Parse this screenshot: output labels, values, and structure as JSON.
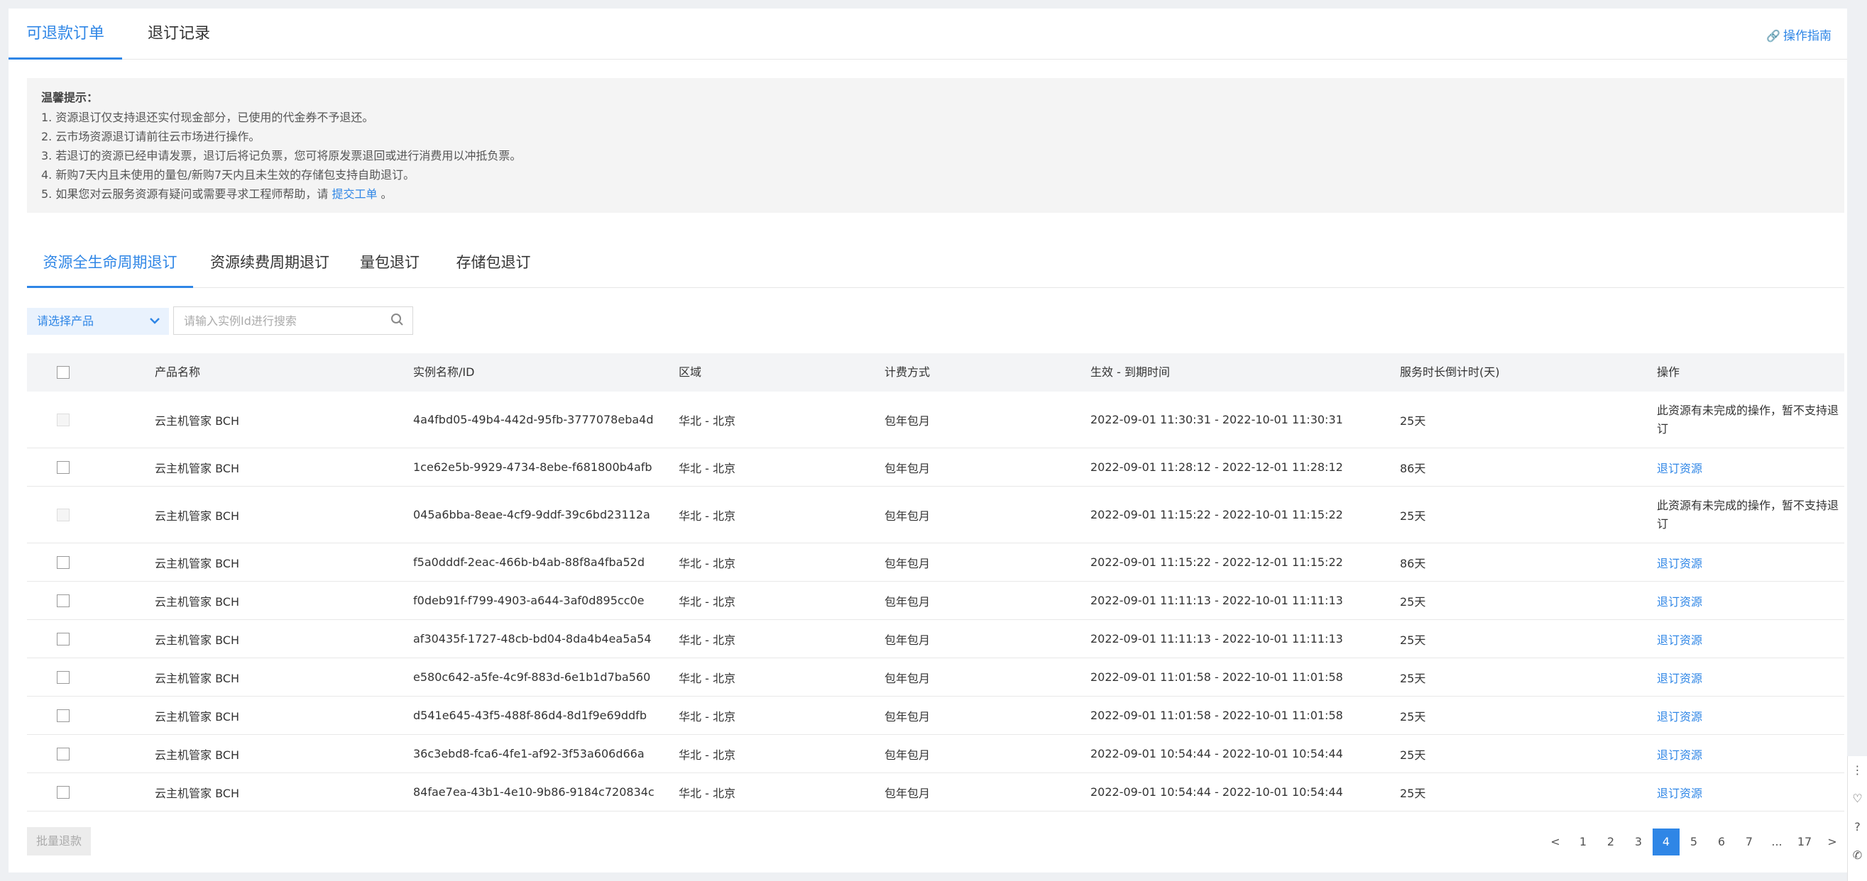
{
  "top_tabs": [
    {
      "label": "可退款订单",
      "active": true
    },
    {
      "label": "退订记录",
      "active": false
    }
  ],
  "guide_link": "操作指南",
  "notice": {
    "title": "温馨提示：",
    "lines": [
      "1. 资源退订仅支持退还实付现金部分，已使用的代金券不予退还。",
      "2. 云市场资源退订请前往云市场进行操作。",
      "3. 若退订的资源已经申请发票，退订后将记负票，您可将原发票退回或进行消费用以冲抵负票。",
      "4. 新购7天内且未使用的量包/新购7天内且未生效的存储包支持自助退订。",
      "5. 如果您对云服务资源有疑问或需要寻求工程师帮助，请 "
    ],
    "link_text": "提交工单",
    "link_suffix": " 。"
  },
  "sub_tabs": [
    {
      "label": "资源全生命周期退订",
      "active": true
    },
    {
      "label": "资源续费周期退订",
      "active": false
    },
    {
      "label": "量包退订",
      "active": false
    },
    {
      "label": "存储包退订",
      "active": false
    }
  ],
  "filters": {
    "product_select": "请选择产品",
    "search_placeholder": "请输入实例Id进行搜索"
  },
  "table": {
    "headers": [
      "产品名称",
      "实例名称/ID",
      "区域",
      "计费方式",
      "生效 - 到期时间",
      "服务时长倒计时(天)",
      "操作"
    ],
    "rows": [
      {
        "product": "云主机管家 BCH",
        "instance": "4a4fbd05-49b4-442d-95fb-3777078eba4d",
        "region": "华北 - 北京",
        "billing": "包年包月",
        "period": "2022-09-01 11:30:31 - 2022-10-01 11:30:31",
        "days": "25天",
        "action": "此资源有未完成的操作，暂不支持退订",
        "disabled": true
      },
      {
        "product": "云主机管家 BCH",
        "instance": "1ce62e5b-9929-4734-8ebe-f681800b4afb",
        "region": "华北 - 北京",
        "billing": "包年包月",
        "period": "2022-09-01 11:28:12 - 2022-12-01 11:28:12",
        "days": "86天",
        "action": "退订资源",
        "disabled": false
      },
      {
        "product": "云主机管家 BCH",
        "instance": "045a6bba-8eae-4cf9-9ddf-39c6bd23112a",
        "region": "华北 - 北京",
        "billing": "包年包月",
        "period": "2022-09-01 11:15:22 - 2022-10-01 11:15:22",
        "days": "25天",
        "action": "此资源有未完成的操作，暂不支持退订",
        "disabled": true
      },
      {
        "product": "云主机管家 BCH",
        "instance": "f5a0dddf-2eac-466b-b4ab-88f8a4fba52d",
        "region": "华北 - 北京",
        "billing": "包年包月",
        "period": "2022-09-01 11:15:22 - 2022-12-01 11:15:22",
        "days": "86天",
        "action": "退订资源",
        "disabled": false
      },
      {
        "product": "云主机管家 BCH",
        "instance": "f0deb91f-f799-4903-a644-3af0d895cc0e",
        "region": "华北 - 北京",
        "billing": "包年包月",
        "period": "2022-09-01 11:11:13 - 2022-10-01 11:11:13",
        "days": "25天",
        "action": "退订资源",
        "disabled": false
      },
      {
        "product": "云主机管家 BCH",
        "instance": "af30435f-1727-48cb-bd04-8da4b4ea5a54",
        "region": "华北 - 北京",
        "billing": "包年包月",
        "period": "2022-09-01 11:11:13 - 2022-10-01 11:11:13",
        "days": "25天",
        "action": "退订资源",
        "disabled": false
      },
      {
        "product": "云主机管家 BCH",
        "instance": "e580c642-a5fe-4c9f-883d-6e1b1d7ba560",
        "region": "华北 - 北京",
        "billing": "包年包月",
        "period": "2022-09-01 11:01:58 - 2022-10-01 11:01:58",
        "days": "25天",
        "action": "退订资源",
        "disabled": false
      },
      {
        "product": "云主机管家 BCH",
        "instance": "d541e645-43f5-488f-86d4-8d1f9e69ddfb",
        "region": "华北 - 北京",
        "billing": "包年包月",
        "period": "2022-09-01 11:01:58 - 2022-10-01 11:01:58",
        "days": "25天",
        "action": "退订资源",
        "disabled": false
      },
      {
        "product": "云主机管家 BCH",
        "instance": "36c3ebd8-fca6-4fe1-af92-3f53a606d66a",
        "region": "华北 - 北京",
        "billing": "包年包月",
        "period": "2022-09-01 10:54:44 - 2022-10-01 10:54:44",
        "days": "25天",
        "action": "退订资源",
        "disabled": false
      },
      {
        "product": "云主机管家 BCH",
        "instance": "84fae7ea-43b1-4e10-9b86-9184c720834c",
        "region": "华北 - 北京",
        "billing": "包年包月",
        "period": "2022-09-01 10:54:44 - 2022-10-01 10:54:44",
        "days": "25天",
        "action": "退订资源",
        "disabled": false
      }
    ]
  },
  "batch_button": "批量退款",
  "pagination": {
    "items": [
      "<",
      "1",
      "2",
      "3",
      "4",
      "5",
      "6",
      "7",
      "...",
      "17",
      ">"
    ],
    "current": "4"
  },
  "colors": {
    "accent": "#2f86e6"
  }
}
